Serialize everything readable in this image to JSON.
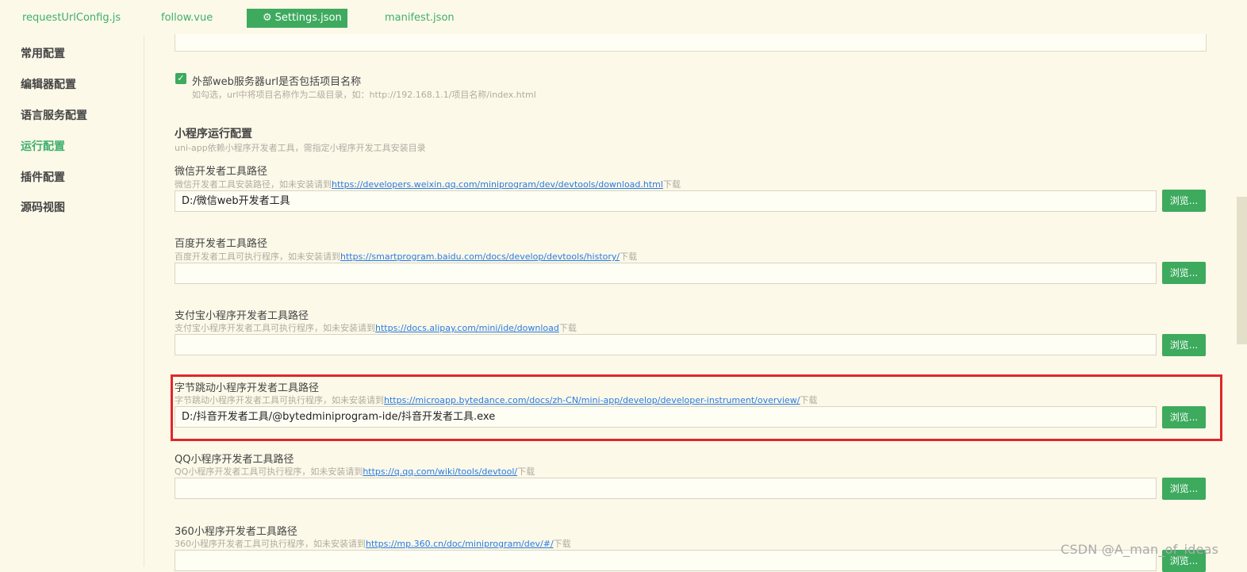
{
  "tabs": [
    {
      "label": "requestUrlConfig.js"
    },
    {
      "label": "follow.vue"
    },
    {
      "label": "Settings.json"
    },
    {
      "label": "manifest.json"
    }
  ],
  "sidebar": {
    "items": [
      {
        "label": "常用配置"
      },
      {
        "label": "编辑器配置"
      },
      {
        "label": "语言服务配置"
      },
      {
        "label": "运行配置"
      },
      {
        "label": "插件配置"
      },
      {
        "label": "源码视图"
      }
    ],
    "active": "运行配置"
  },
  "external_web": {
    "checked": true,
    "label": "外部web服务器url是否包括项目名称",
    "hint": "如勾选，url中将项目名称作为二级目录，如：http://192.168.1.1/项目名称/index.html"
  },
  "miniprogram": {
    "title": "小程序运行配置",
    "subtitle": "uni-app依赖小程序开发者工具，需指定小程序开发工具安装目录",
    "browse_label": "浏览...",
    "fields": [
      {
        "label": "微信开发者工具路径",
        "hint_prefix": "微信开发者工具安装路径，如未安装请到",
        "link": "https://developers.weixin.qq.com/miniprogram/dev/devtools/download.html",
        "hint_suffix": "下载",
        "value": "D:/微信web开发者工具"
      },
      {
        "label": "百度开发者工具路径",
        "hint_prefix": "百度开发者工具可执行程序，如未安装请到",
        "link": "https://smartprogram.baidu.com/docs/develop/devtools/history/",
        "hint_suffix": "下载",
        "value": ""
      },
      {
        "label": "支付宝小程序开发者工具路径",
        "hint_prefix": "支付宝小程序开发者工具可执行程序，如未安装请到",
        "link": "https://docs.alipay.com/mini/ide/download",
        "hint_suffix": "下载",
        "value": ""
      },
      {
        "label": "字节跳动小程序开发者工具路径",
        "hint_prefix": "字节跳动小程序开发者工具可执行程序，如未安装请到",
        "link": "https://microapp.bytedance.com/docs/zh-CN/mini-app/develop/developer-instrument/overview/",
        "hint_suffix": "下载",
        "value": "D:/抖音开发者工具/@bytedminiprogram-ide/抖音开发者工具.exe"
      },
      {
        "label": "QQ小程序开发者工具路径",
        "hint_prefix": "QQ小程序开发者工具可执行程序，如未安装请到",
        "link": "https://q.qq.com/wiki/tools/devtool/",
        "hint_suffix": "下载",
        "value": ""
      },
      {
        "label": "360小程序开发者工具路径",
        "hint_prefix": "360小程序开发者工具可执行程序，如未安装请到",
        "link": "https://mp.360.cn/doc/miniprogram/dev/#/",
        "hint_suffix": "下载",
        "value": ""
      }
    ]
  },
  "watermark": "CSDN @A_man_of_ideas",
  "colors": {
    "accent": "#3daa5e",
    "link": "#2a7ae2",
    "highlight": "#e0262b",
    "background": "#fcf9e9"
  }
}
